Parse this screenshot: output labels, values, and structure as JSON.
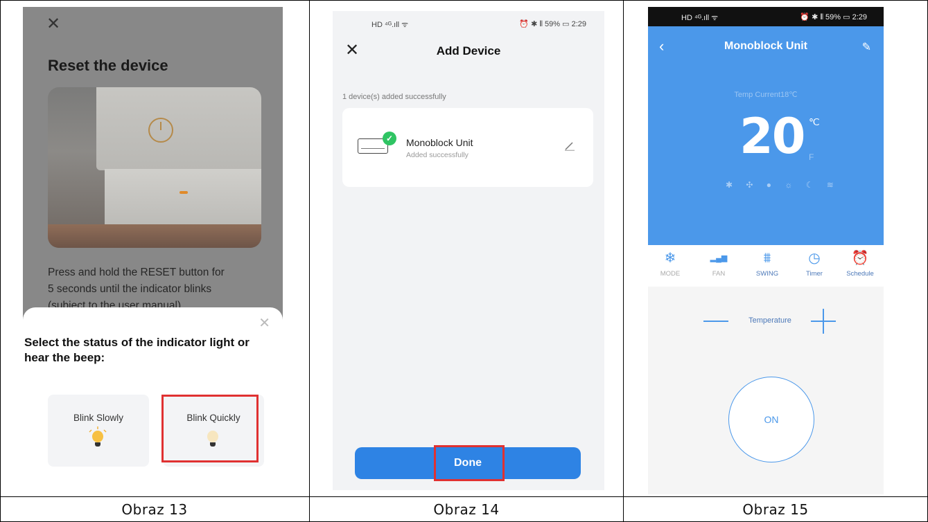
{
  "captions": [
    "Obraz  13",
    "Obraz  14",
    "Obraz  15"
  ],
  "panel13": {
    "close_glyph": "✕",
    "title": "Reset the device",
    "instruction_line1": "Press and hold the RESET button for",
    "instruction_line2": "5 seconds until the indicator blinks",
    "instruction_line3": "(subject to the user manual)",
    "sheet_close_glyph": "✕",
    "sheet_title": "Select the status of the indicator light or hear the beep:",
    "options": [
      {
        "label": "Blink Slowly",
        "icon": "bulb-lit-icon"
      },
      {
        "label": "Blink Quickly",
        "icon": "bulb-dim-icon"
      }
    ],
    "highlight_color": "#e03131"
  },
  "panel14": {
    "status_left": "HD ⁴ᴳ.ıll ᯤ",
    "status_right": "⏰ ✱ ⫴ 59% ▭ 2:29",
    "close_glyph": "✕",
    "title": "Add Device",
    "added_note": "1 device(s) added successfully",
    "device_name": "Monoblock Unit",
    "device_status": "Added successfully",
    "check_glyph": "✓",
    "done_label": "Done",
    "accent": "#2e83e4"
  },
  "panel15": {
    "status_left": "HD ⁴ᴳ.ıll ᯤ",
    "status_right": "⏰ ✱ ⫴ 59% ▭ 2:29",
    "back_glyph": "‹",
    "title": "Monoblock Unit",
    "edit_glyph": "✎",
    "temp_current": "Temp Current18℃",
    "temp_value": "20",
    "unit_c": "℃",
    "unit_f": "F",
    "mode_icons": "✱ ✣ ● ☼ ☾ ≋",
    "buttons": [
      {
        "label": "MODE",
        "icon": "snowflake-icon",
        "glyph": "❄"
      },
      {
        "label": "FAN",
        "icon": "fan-bars-icon",
        "glyph": "▂▄▆"
      },
      {
        "label": "SWING",
        "icon": "swing-icon",
        "glyph": "⩩"
      },
      {
        "label": "Timer",
        "icon": "clock-icon",
        "glyph": "◷"
      },
      {
        "label": "Schedule",
        "icon": "alarm-icon",
        "glyph": "⏰"
      }
    ],
    "temperature_label": "Temperature",
    "power_label": "ON",
    "accent": "#4b98ea"
  }
}
